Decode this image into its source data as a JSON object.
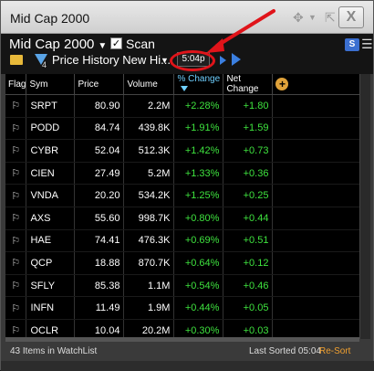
{
  "window": {
    "title": "Mid Cap 2000",
    "close_label": "X",
    "move_icon": "move-arrows-icon",
    "pop_icon": "popout-icon"
  },
  "header": {
    "watchlist_name": "Mid Cap 2000",
    "scan_label": "Scan",
    "scan_checked": true,
    "filter_count": "4",
    "filter_label": "Price History New Hi...",
    "time": "5:04p",
    "logo_letter": "S"
  },
  "table": {
    "columns": [
      "Flag",
      "Sym",
      "Price",
      "Volume",
      "% Change",
      "Net Change"
    ],
    "add_column_label": "+",
    "rows": [
      {
        "sym": "SRPT",
        "price": "80.90",
        "volume": "2.2M",
        "pct": "+2.28%",
        "net": "+1.80"
      },
      {
        "sym": "PODD",
        "price": "84.74",
        "volume": "439.8K",
        "pct": "+1.91%",
        "net": "+1.59"
      },
      {
        "sym": "CYBR",
        "price": "52.04",
        "volume": "512.3K",
        "pct": "+1.42%",
        "net": "+0.73"
      },
      {
        "sym": "CIEN",
        "price": "27.49",
        "volume": "5.2M",
        "pct": "+1.33%",
        "net": "+0.36"
      },
      {
        "sym": "VNDA",
        "price": "20.20",
        "volume": "534.2K",
        "pct": "+1.25%",
        "net": "+0.25"
      },
      {
        "sym": "AXS",
        "price": "55.60",
        "volume": "998.7K",
        "pct": "+0.80%",
        "net": "+0.44"
      },
      {
        "sym": "HAE",
        "price": "74.41",
        "volume": "476.3K",
        "pct": "+0.69%",
        "net": "+0.51"
      },
      {
        "sym": "QCP",
        "price": "18.88",
        "volume": "870.7K",
        "pct": "+0.64%",
        "net": "+0.12"
      },
      {
        "sym": "SFLY",
        "price": "85.38",
        "volume": "1.1M",
        "pct": "+0.54%",
        "net": "+0.46"
      },
      {
        "sym": "INFN",
        "price": "11.49",
        "volume": "1.9M",
        "pct": "+0.44%",
        "net": "+0.05"
      },
      {
        "sym": "OCLR",
        "price": "10.04",
        "volume": "20.2M",
        "pct": "+0.30%",
        "net": "+0.03"
      }
    ]
  },
  "status": {
    "items_text": "43 Items in WatchList",
    "last_sorted": "Last Sorted 05:04",
    "resort_label": "Re-Sort"
  },
  "colors": {
    "positive": "#3ee23e",
    "accent_orange": "#f0a030",
    "highlight_red": "#e0141a"
  }
}
